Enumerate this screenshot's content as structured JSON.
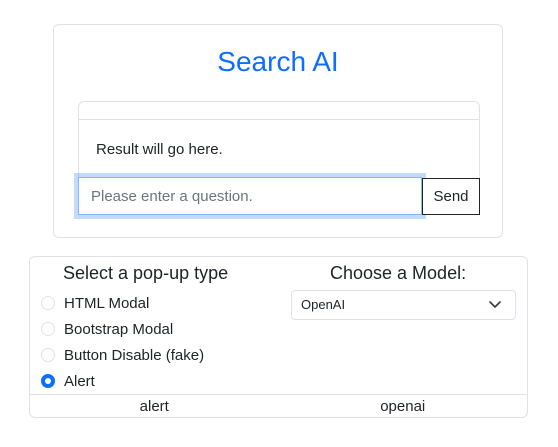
{
  "search": {
    "title": "Search AI",
    "result_text": "Result will go here.",
    "input_value": "",
    "input_placeholder": "Please enter a question.",
    "send_label": "Send"
  },
  "popup": {
    "title": "Select a pop-up type",
    "options": [
      {
        "label": "HTML Modal",
        "checked": false
      },
      {
        "label": "Bootstrap Modal",
        "checked": false
      },
      {
        "label": "Button Disable (fake)",
        "checked": false
      },
      {
        "label": "Alert",
        "checked": true
      }
    ]
  },
  "model": {
    "title": "Choose a Model:",
    "selected": "OpenAI"
  },
  "status": {
    "popup_value": "alert",
    "model_value": "openai"
  },
  "colors": {
    "accent": "#0d6efd",
    "border": "#dee2e6",
    "text": "#212529"
  },
  "icons": {
    "select_arrow": "chevron-down-icon"
  }
}
